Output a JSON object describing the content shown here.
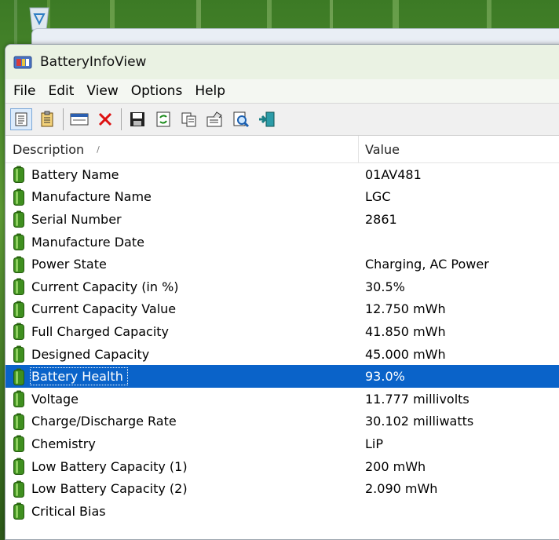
{
  "window": {
    "title": "BatteryInfoView"
  },
  "menu": [
    "File",
    "Edit",
    "View",
    "Options",
    "Help"
  ],
  "toolbar": {
    "icons": [
      "html-report-icon",
      "properties-list-icon",
      "advanced-options-icon",
      "delete-icon",
      "save-icon",
      "refresh-icon",
      "copy-icon",
      "properties-icon",
      "find-icon",
      "exit-icon"
    ]
  },
  "columns": {
    "description": "Description",
    "value": "Value"
  },
  "rows": [
    {
      "desc": "Battery Name",
      "val": "01AV481"
    },
    {
      "desc": "Manufacture Name",
      "val": "LGC"
    },
    {
      "desc": "Serial Number",
      "val": " 2861"
    },
    {
      "desc": "Manufacture Date",
      "val": ""
    },
    {
      "desc": "Power State",
      "val": "Charging, AC Power"
    },
    {
      "desc": "Current Capacity (in %)",
      "val": "30.5%"
    },
    {
      "desc": "Current Capacity Value",
      "val": "12.750 mWh"
    },
    {
      "desc": "Full Charged Capacity",
      "val": "41.850 mWh"
    },
    {
      "desc": "Designed Capacity",
      "val": "45.000 mWh"
    },
    {
      "desc": "Battery Health",
      "val": "93.0%",
      "selected": true
    },
    {
      "desc": "Voltage",
      "val": "11.777 millivolts"
    },
    {
      "desc": "Charge/Discharge Rate",
      "val": "30.102 milliwatts"
    },
    {
      "desc": "Chemistry",
      "val": "LiP"
    },
    {
      "desc": "Low Battery Capacity (1)",
      "val": "200 mWh"
    },
    {
      "desc": "Low Battery Capacity (2)",
      "val": "2.090 mWh"
    },
    {
      "desc": "Critical Bias",
      "val": ""
    }
  ],
  "colors": {
    "selection": "#0a63c9",
    "battery": "#3f8f1f"
  }
}
